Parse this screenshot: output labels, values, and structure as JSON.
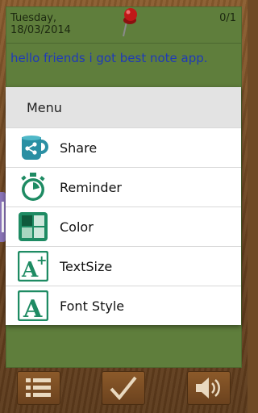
{
  "note": {
    "date_line1": "Tuesday,",
    "date_line2": "18/03/2014",
    "page_counter": "0/1",
    "text": "hello friends i got best note app."
  },
  "menu": {
    "title": "Menu",
    "items": [
      {
        "label": "Share",
        "icon": "share-mug-icon"
      },
      {
        "label": "Reminder",
        "icon": "stopwatch-icon"
      },
      {
        "label": "Color",
        "icon": "color-grid-icon"
      },
      {
        "label": "TextSize",
        "icon": "text-size-icon"
      },
      {
        "label": "Font Style",
        "icon": "font-style-icon"
      }
    ]
  },
  "toolbar": {
    "buttons": [
      {
        "name": "list-view",
        "icon": "list-icon"
      },
      {
        "name": "save",
        "icon": "check-icon"
      },
      {
        "name": "speak",
        "icon": "speaker-icon"
      }
    ]
  },
  "colors": {
    "note_green": "#5f7e3c",
    "note_text_blue": "#1f3ab8",
    "icon_green": "#1e8b63",
    "menu_header_gray": "#e3e3e3"
  }
}
